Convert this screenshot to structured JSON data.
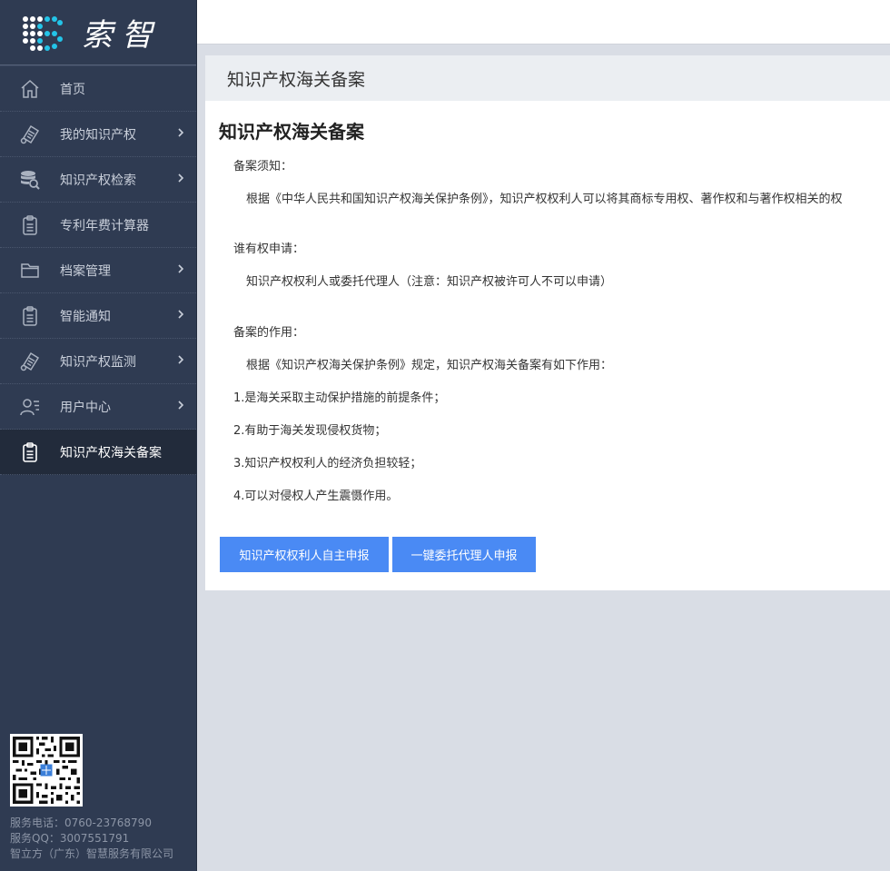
{
  "brand": {
    "name": "索智"
  },
  "sidebar": {
    "items": [
      {
        "label": "首页",
        "icon": "home-icon",
        "has_arrow": false,
        "active": false
      },
      {
        "label": "我的知识产权",
        "icon": "certificate-icon",
        "has_arrow": true,
        "active": false
      },
      {
        "label": "知识产权检索",
        "icon": "database-search-icon",
        "has_arrow": true,
        "active": false
      },
      {
        "label": "专利年费计算器",
        "icon": "clipboard-icon",
        "has_arrow": false,
        "active": false
      },
      {
        "label": "档案管理",
        "icon": "folder-icon",
        "has_arrow": true,
        "active": false
      },
      {
        "label": "智能通知",
        "icon": "clipboard-icon",
        "has_arrow": true,
        "active": false
      },
      {
        "label": "知识产权监测",
        "icon": "certificate-icon",
        "has_arrow": true,
        "active": false
      },
      {
        "label": "用户中心",
        "icon": "user-list-icon",
        "has_arrow": true,
        "active": false
      },
      {
        "label": "知识产权海关备案",
        "icon": "clipboard-icon",
        "has_arrow": false,
        "active": true
      }
    ],
    "footer": {
      "phone": "服务电话：0760-23768790",
      "qq": "服务QQ：3007551791",
      "company": "智立方（广东）智慧服务有限公司"
    }
  },
  "page": {
    "header": "知识产权海关备案",
    "title": "知识产权海关备案",
    "notice_label": "备案须知：",
    "notice_text": "根据《中华人民共和国知识产权海关保护条例》，知识产权权利人可以将其商标专用权、著作权和与著作权相关的权",
    "who_label": "谁有权申请：",
    "who_text": "知识产权权利人或委托代理人（注意：知识产权被许可人不可以申请）",
    "role_label": "备案的作用：",
    "role_text": "根据《知识产权海关保护条例》规定，知识产权海关备案有如下作用：",
    "points": [
      "1.是海关采取主动保护措施的前提条件；",
      "2.有助于海关发现侵权货物；",
      "3.知识产权权利人的经济负担较轻；",
      "4.可以对侵权人产生震慑作用。"
    ],
    "btn_self": "知识产权权利人自主申报",
    "btn_agent": "一键委托代理人申报"
  },
  "colors": {
    "sidebar_bg": "#2f3b52",
    "accent": "#4a8af4",
    "page_bg": "#d9dde5"
  }
}
